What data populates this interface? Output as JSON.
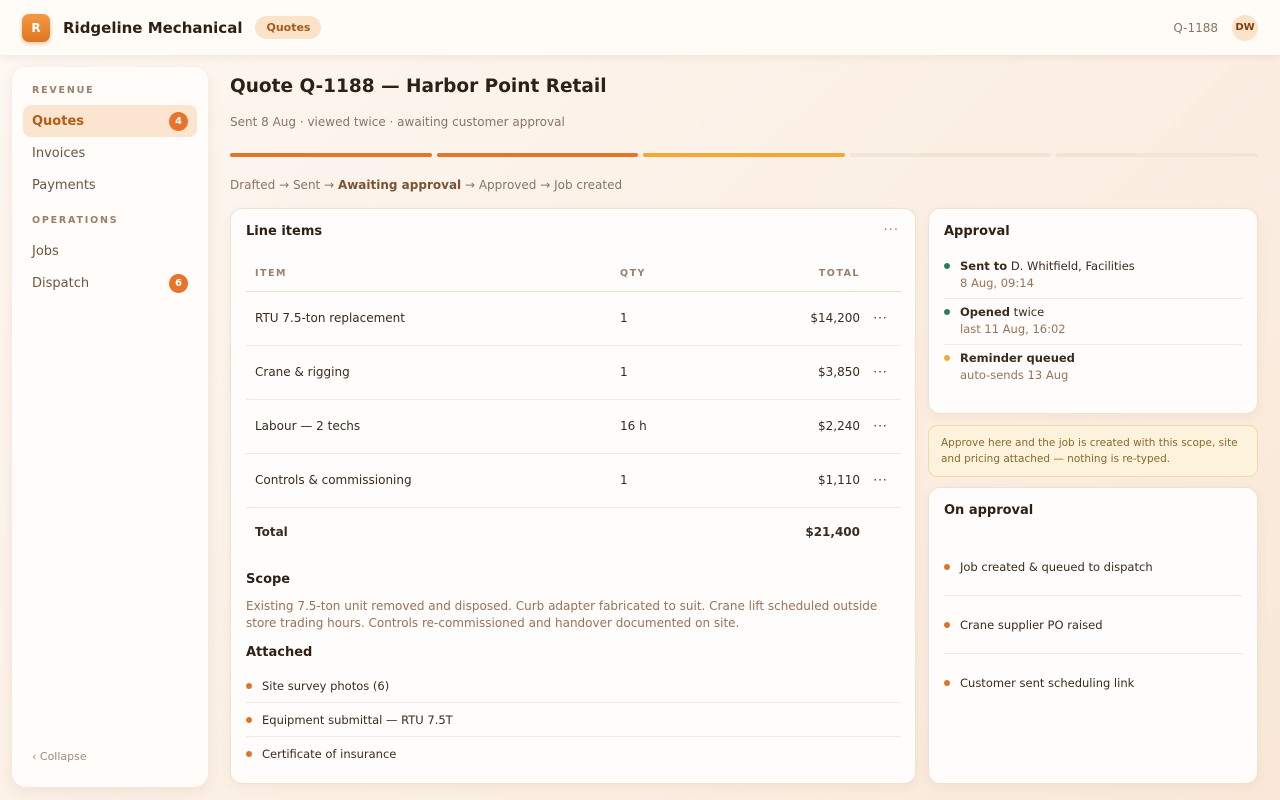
{
  "app": {
    "logo_letter": "R",
    "name": "Ridgeline Mechanical",
    "section_pill": "Quotes",
    "quote_ref": "Q-1188",
    "user_initials": "DW"
  },
  "sidebar": {
    "section1": "REVENUE",
    "items1": [
      {
        "label": "Quotes",
        "badge": "4",
        "active": true
      },
      {
        "label": "Invoices"
      },
      {
        "label": "Payments"
      }
    ],
    "section2": "OPERATIONS",
    "items2": [
      {
        "label": "Jobs"
      },
      {
        "label": "Dispatch",
        "badge": "6"
      }
    ],
    "collapse": "‹ Collapse"
  },
  "header": {
    "title": "Quote Q-1188 — Harbor Point Retail",
    "subtitle": "Sent 8 Aug · viewed twice · awaiting customer approval",
    "progress": {
      "total_stages": 5,
      "completed": 2,
      "current": 3
    },
    "steps": {
      "s1": "Drafted",
      "s2": "Sent",
      "s3": "Awaiting approval",
      "s4": "Approved",
      "s5": "Job created",
      "arrow": " → "
    }
  },
  "line_items": {
    "title": "Line items",
    "more": "···",
    "columns": {
      "item": "ITEM",
      "qty": "QTY",
      "total": "TOTAL"
    },
    "rows": [
      {
        "item": "RTU 7.5-ton replacement",
        "qty": "1",
        "total": "$14,200"
      },
      {
        "item": "Crane & rigging",
        "qty": "1",
        "total": "$3,850"
      },
      {
        "item": "Labour — 2 techs",
        "qty": "16 h",
        "total": "$2,240"
      },
      {
        "item": "Controls & commissioning",
        "qty": "1",
        "total": "$1,110"
      }
    ],
    "total_label": "Total",
    "total_value": "$21,400",
    "scope_title": "Scope",
    "scope_text": "Existing 7.5-ton unit removed and disposed. Curb adapter fabricated to suit. Crane lift scheduled outside store trading hours. Controls re-commissioned and handover documented on site.",
    "attached_title": "Attached",
    "attached": [
      "Site survey photos (6)",
      "Equipment submittal — RTU 7.5T",
      "Certificate of insurance"
    ]
  },
  "approval": {
    "title": "Approval",
    "events": [
      {
        "bold": "Sent to",
        "rest": " D. Whitfield, Facilities",
        "sub": "8 Aug, 09:14",
        "status": "green"
      },
      {
        "bold": "Opened",
        "rest": " twice",
        "sub": "last 11 Aug, 16:02",
        "status": "green"
      },
      {
        "bold": "Reminder queued",
        "rest": "",
        "sub": "auto-sends 13 Aug",
        "status": "amber"
      }
    ]
  },
  "note": "Approve here and the job is created with this scope, site and pricing attached — nothing is re-typed.",
  "on_approval": {
    "title": "On approval",
    "items": [
      "Job created & queued to dispatch",
      "Crane supplier PO raised",
      "Customer sent scheduling link"
    ]
  },
  "colors": {
    "accent": "#e3762b",
    "warning": "#f0a838",
    "success": "#2e7d55"
  }
}
